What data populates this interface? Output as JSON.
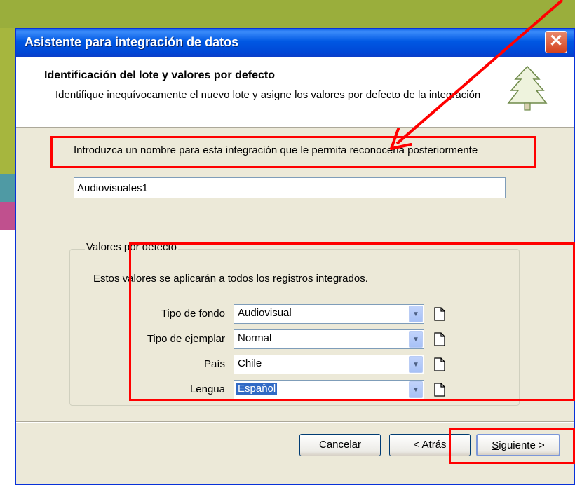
{
  "dialog": {
    "title": "Asistente para integración de datos",
    "close_glyph": "✕"
  },
  "header": {
    "title": "Identificación del lote y valores por defecto",
    "description": "Identifique inequívocamente el nuevo lote y asigne los valores por defecto de la integración",
    "icon": "tree-icon"
  },
  "batch": {
    "prompt": "Introduzca un nombre para esta integración que le permita reconocerla posteriormente",
    "name_value": "Audiovisuales1"
  },
  "defaults": {
    "legend": "Valores por defecto",
    "description": "Estos valores se aplicarán a todos los registros integrados.",
    "fields": [
      {
        "label": "Tipo de fondo",
        "value": "Audiovisual"
      },
      {
        "label": "Tipo de ejemplar",
        "value": "Normal"
      },
      {
        "label": "País",
        "value": "Chile"
      },
      {
        "label": "Lengua",
        "value": "Español"
      }
    ]
  },
  "buttons": {
    "cancel": "Cancelar",
    "back": "< Atrás",
    "next_underlined": "S",
    "next_rest": "iguiente >"
  },
  "colors": {
    "title_bar": "#0054e3",
    "annotation": "#ff0000",
    "dialog_bg": "#ece9d8"
  }
}
